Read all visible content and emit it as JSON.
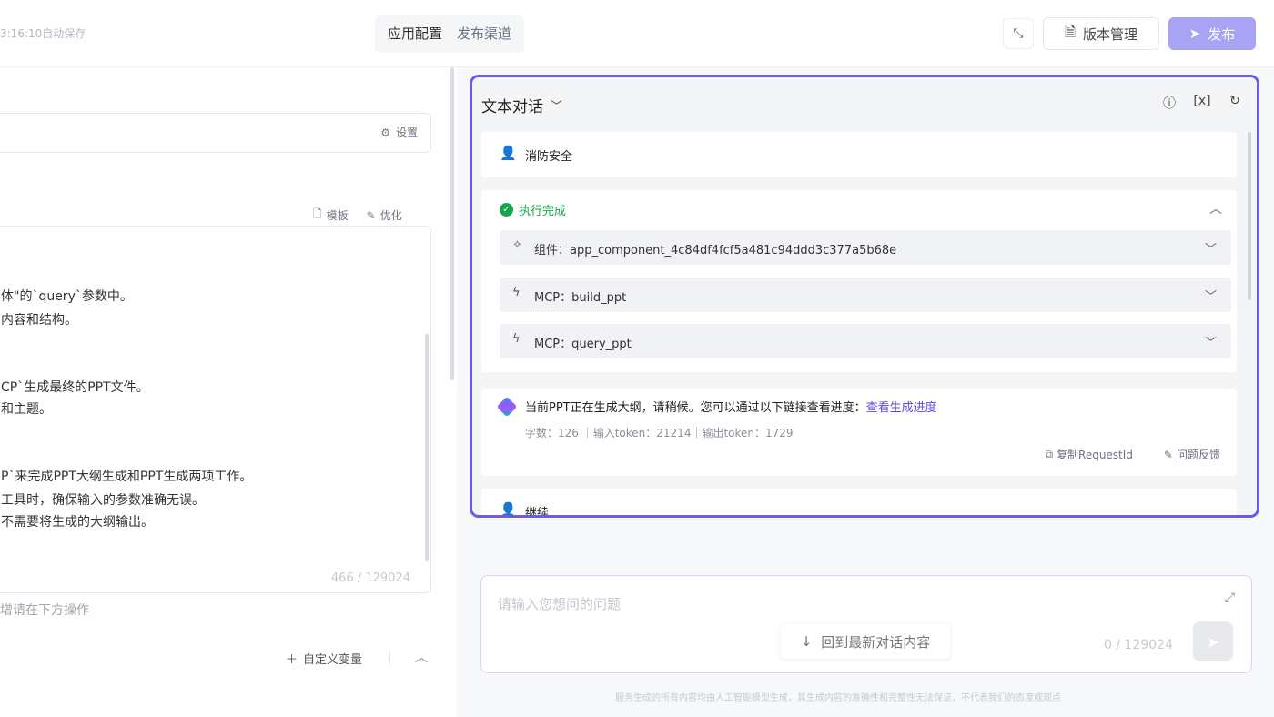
{
  "topbar": {
    "autosave": "3:16:10自动保存",
    "tabs": [
      "应用配置",
      "发布渠道"
    ],
    "version_label": "版本管理",
    "publish_label": "发布"
  },
  "left": {
    "settings_label": "设置",
    "template_label": "模板",
    "optimize_label": "优化",
    "prompt_lines": [
      "体\"的`query`参数中。",
      "内容和结构。",
      "CP`生成最终的PPT文件。",
      "和主题。",
      "P`来完成PPT大纲生成和PPT生成两项工作。",
      "工具时，确保输入的参数准确无误。",
      "不需要将生成的大纲输出。"
    ],
    "char_count": "466 / 129024",
    "hint": "增请在下方操作",
    "custom_var_label": "自定义变量"
  },
  "chat": {
    "title": "文本对话",
    "user_msg_1": "消防安全",
    "exec_status": "执行完成",
    "tools": [
      {
        "icon": "sparkle-icon",
        "label": "组件：app_component_4c84df4fcf5a481c94ddd3c377a5b68e"
      },
      {
        "icon": "bolt-icon",
        "label": "MCP：build_ppt"
      },
      {
        "icon": "bolt-icon",
        "label": "MCP：query_ppt"
      }
    ],
    "bot_text": "当前PPT正在生成大纲，请稍候。您可以通过以下链接查看进度：",
    "bot_link": "查看生成进度",
    "bot_stats": "字数：126  ｜输入token：21214｜输出token：1729",
    "copy_label": "复制RequestId",
    "feedback_label": "问题反馈",
    "user_msg_2": "继续"
  },
  "input": {
    "placeholder": "请输入您想问的问题",
    "count": "0 / 129024",
    "back_latest": "回到最新对话内容",
    "disclaimer": "服务生成的所有内容均由人工智能模型生成，其生成内容的准确性和完整性无法保证，不代表我们的态度或观点"
  },
  "colors": {
    "accent": "#6b5ce7",
    "publish_bg": "#a8a3f3",
    "success": "#16a34a",
    "link": "#5b4ee0"
  }
}
